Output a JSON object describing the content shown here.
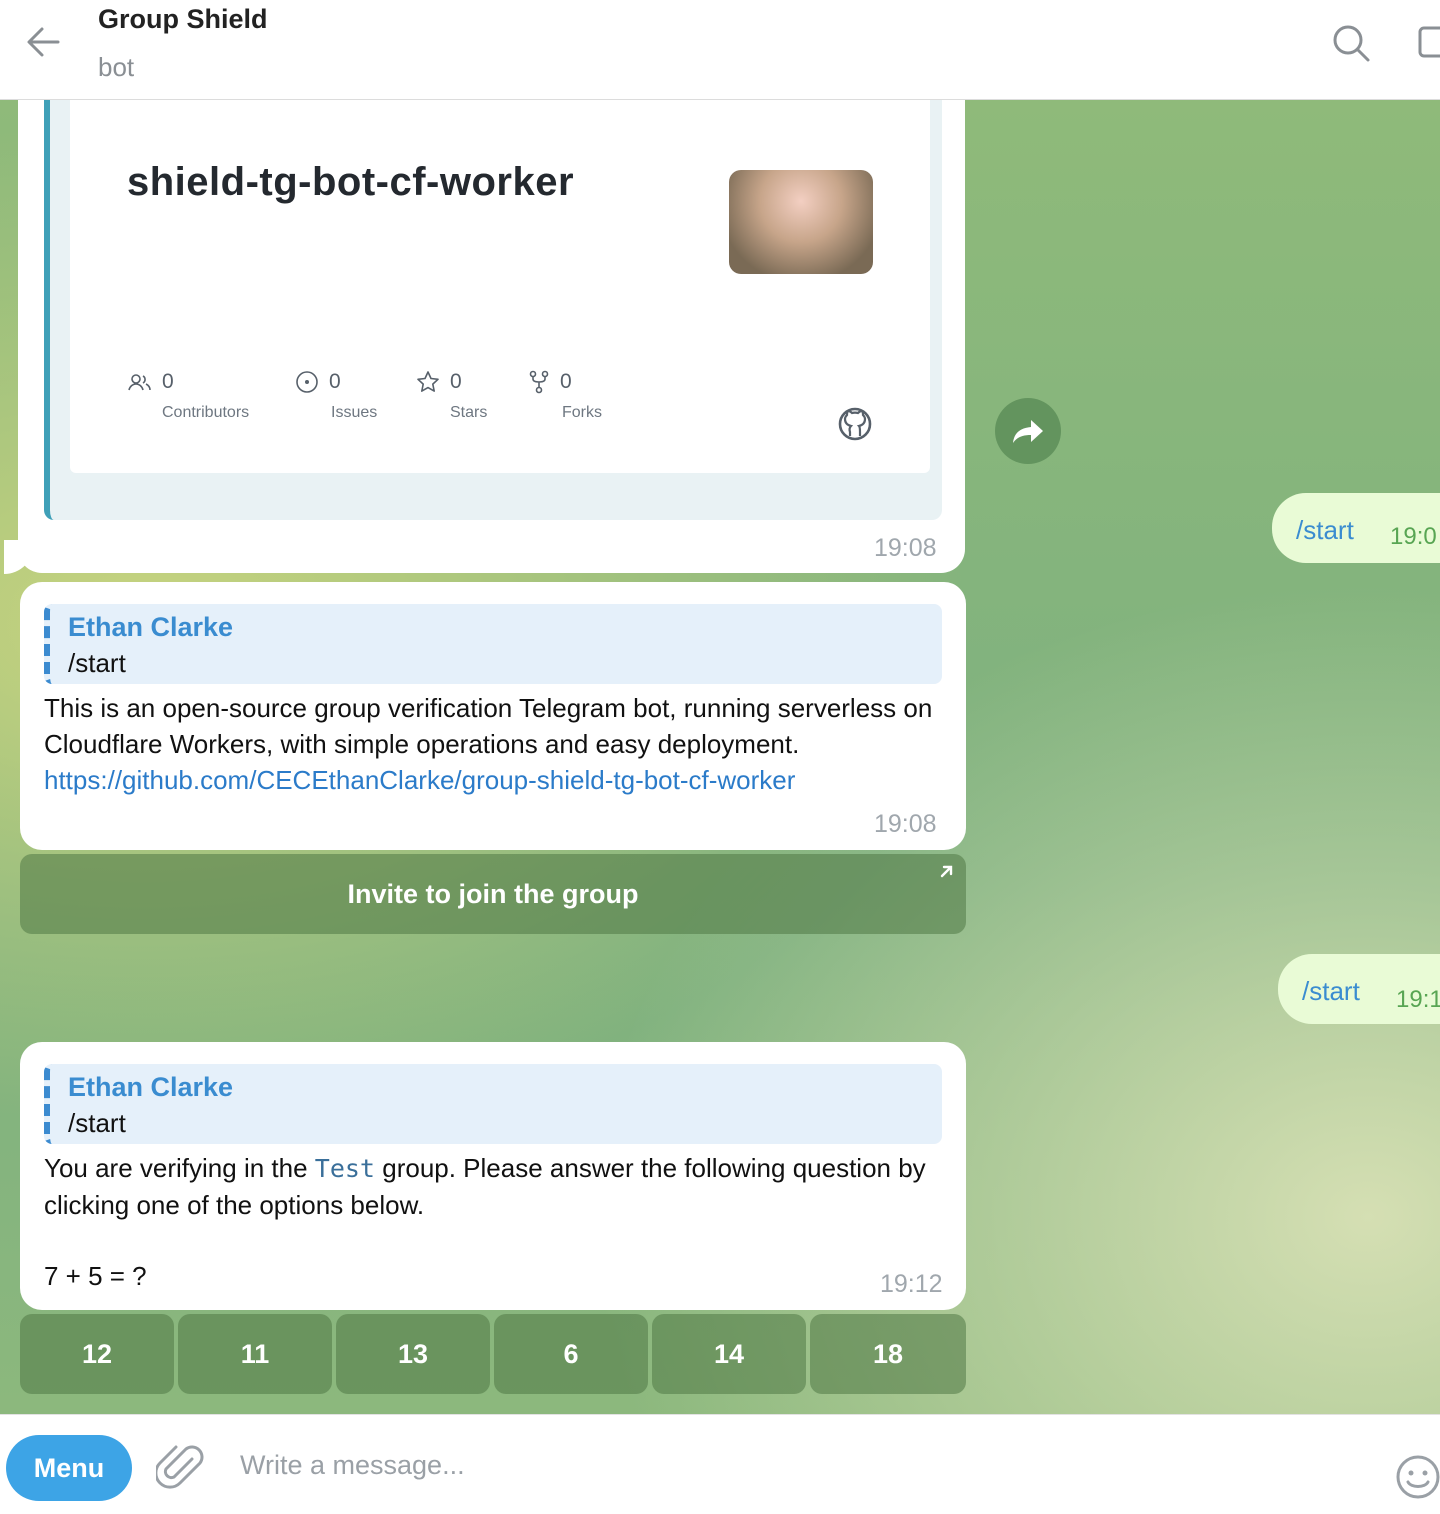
{
  "header": {
    "title": "Group Shield",
    "subtitle": "bot"
  },
  "messages": {
    "link_preview": {
      "repo_name": "shield-tg-bot-cf-worker",
      "stats": [
        {
          "icon": "contributors-icon",
          "value": "0",
          "label": "Contributors"
        },
        {
          "icon": "issues-icon",
          "value": "0",
          "label": "Issues"
        },
        {
          "icon": "star-icon",
          "value": "0",
          "label": "Stars"
        },
        {
          "icon": "fork-icon",
          "value": "0",
          "label": "Forks"
        }
      ],
      "time": "19:08"
    },
    "outgoing_1": {
      "text": "/start",
      "time": "19:0"
    },
    "reply_1": {
      "quote_name": "Ethan Clarke",
      "quote_text": "/start",
      "text": "This is an open-source group verification Telegram bot, running serverless on Cloudflare Workers, with simple operations and easy deployment.",
      "link": "https://github.com/CECEthanClarke/group-shield-tg-bot-cf-worker",
      "time": "19:08",
      "button": "Invite to join the group"
    },
    "outgoing_2": {
      "text": "/start",
      "time": "19:1"
    },
    "reply_2": {
      "quote_name": "Ethan Clarke",
      "quote_text": "/start",
      "text_before": "You are verifying in the",
      "group_name": "Test",
      "text_after": "group. Please answer the following question by clicking one of the options below.",
      "question": "7 + 5 = ?",
      "time": "19:12",
      "options": [
        "12",
        "11",
        "13",
        "6",
        "14",
        "18"
      ]
    }
  },
  "composer": {
    "menu_label": "Menu",
    "placeholder": "Write a message..."
  },
  "colors": {
    "accent": "#3da4e6",
    "link": "#2b7bc9",
    "outgoing_bubble": "#e9fbd6"
  }
}
